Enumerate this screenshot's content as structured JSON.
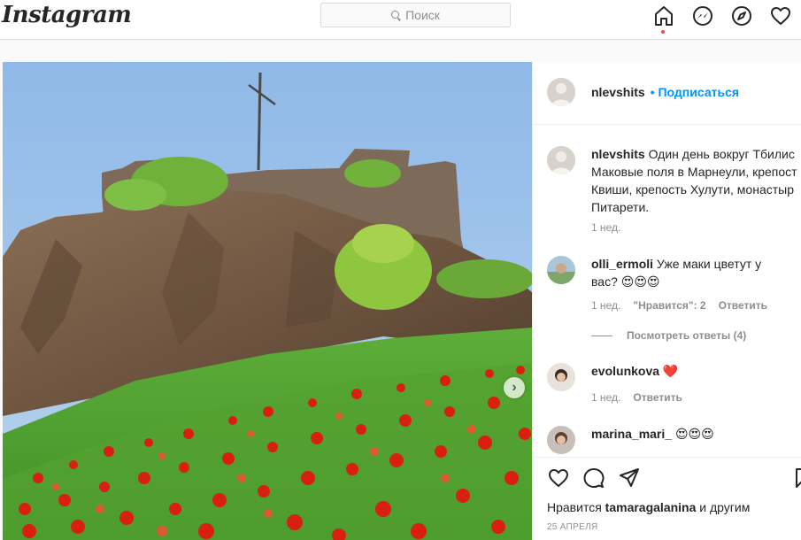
{
  "header": {
    "logo": "Instagram",
    "search_placeholder": "Поиск"
  },
  "nav_icons": [
    "home-icon",
    "messenger-icon",
    "explore-icon",
    "heart-icon"
  ],
  "post": {
    "author": "nlevshits",
    "follow_label": "• Подписаться",
    "caption_lines": [
      "Один день вокруг Тбилис",
      "Маковые поля в Марнеули, крепост",
      "Квиши, крепость Хулути, монастыр",
      "Питарети."
    ],
    "caption_time": "1 нед.",
    "comments": [
      {
        "user": "olli_ermoli",
        "text_line1": "Уже маки цветут у",
        "text_line2": "вас? 😍😍😍",
        "time": "1 нед.",
        "likes": "\"Нравится\": 2",
        "reply": "Ответить",
        "view_replies": "Посмотреть ответы (4)"
      },
      {
        "user": "evolunkova",
        "text": "❤️",
        "time": "1 нед.",
        "reply": "Ответить"
      },
      {
        "user": "marina_mari_",
        "text": "😍😍😍"
      }
    ],
    "likes_prefix": "Нравится",
    "likes_user": "tamaragalanina",
    "likes_suffix": "и другим",
    "date": "25 АПРЕЛЯ"
  },
  "colors": {
    "accent": "#0095f6",
    "notification_dot": "#ed4956",
    "border": "#dbdbdb"
  }
}
